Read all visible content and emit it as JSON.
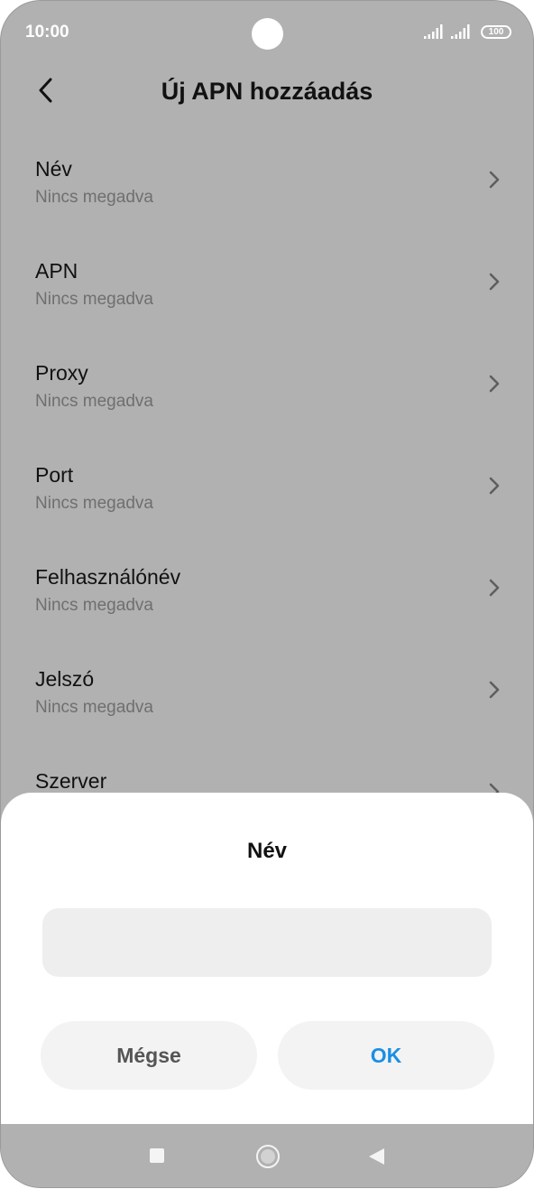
{
  "status_bar": {
    "time": "10:00",
    "battery": "100"
  },
  "header": {
    "title": "Új APN hozzáadás"
  },
  "list": {
    "items": [
      {
        "title": "Név",
        "subtitle": "Nincs megadva"
      },
      {
        "title": "APN",
        "subtitle": "Nincs megadva"
      },
      {
        "title": "Proxy",
        "subtitle": "Nincs megadva"
      },
      {
        "title": "Port",
        "subtitle": "Nincs megadva"
      },
      {
        "title": "Felhasználónév",
        "subtitle": "Nincs megadva"
      },
      {
        "title": "Jelszó",
        "subtitle": "Nincs megadva"
      },
      {
        "title": "Szerver",
        "subtitle": ""
      }
    ]
  },
  "dialog": {
    "title": "Név",
    "input_value": "",
    "cancel_label": "Mégse",
    "ok_label": "OK"
  },
  "colors": {
    "accent": "#1a8fe3",
    "dim_overlay": "#b1b1b1"
  },
  "icons": {
    "back": "back-arrow-icon",
    "chevron": "chevron-right-icon",
    "nav_recents": "square-icon",
    "nav_home": "circle-icon",
    "nav_back": "triangle-back-icon"
  }
}
